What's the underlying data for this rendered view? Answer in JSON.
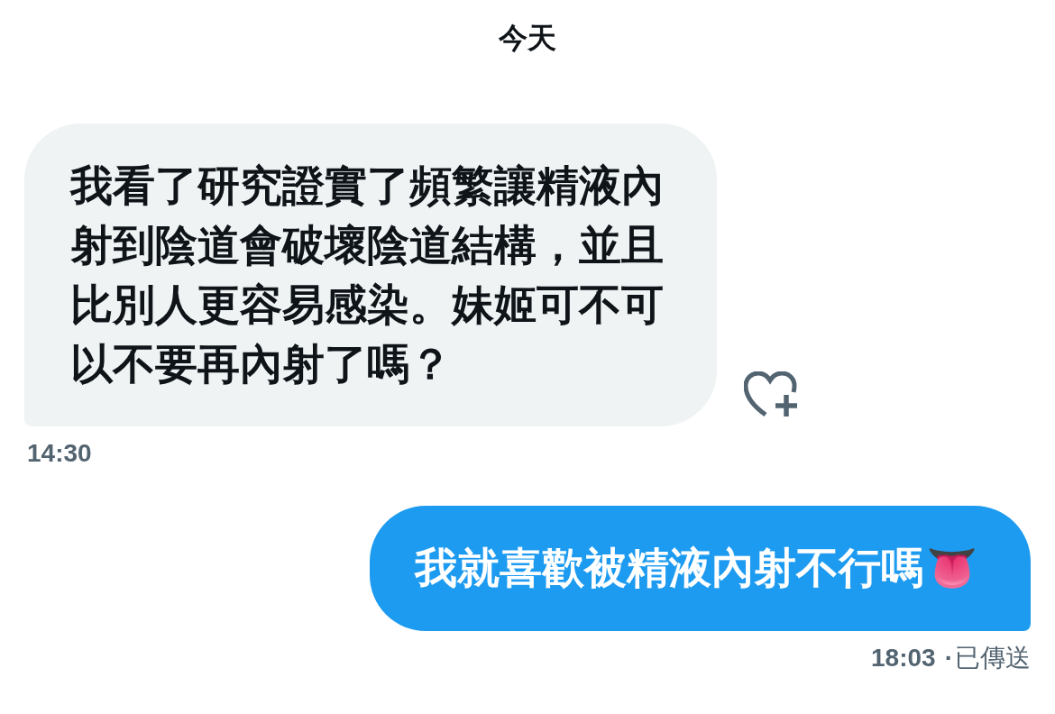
{
  "date_header": "今天",
  "messages": [
    {
      "kind": "received",
      "text": "我看了研究證實了頻繁讓精液內射到陰道會破壞陰道結構，並且比別人更容易感染。妹姬可不可以不要再內射了嗎？",
      "time": "14:30"
    },
    {
      "kind": "sent",
      "text": "我就喜歡被精液內射不行嗎",
      "emoji": "👅",
      "time": "18:03",
      "separator": "·",
      "status": "已傳送"
    }
  ]
}
